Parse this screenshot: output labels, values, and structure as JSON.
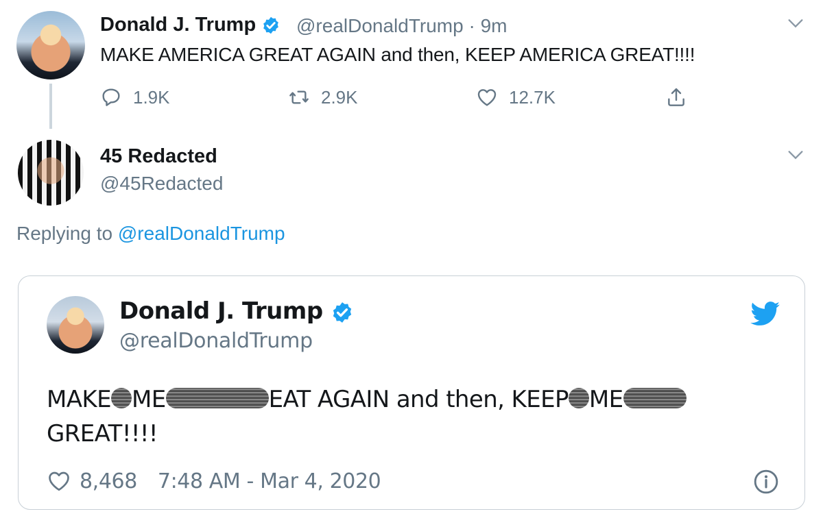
{
  "tweet": {
    "author_name": "Donald J. Trump",
    "handle": "@realDonaldTrump",
    "separator": "·",
    "time": "9m",
    "text": "MAKE AMERICA GREAT AGAIN and then, KEEP AMERICA GREAT!!!!",
    "replies": "1.9K",
    "retweets": "2.9K",
    "likes": "12.7K"
  },
  "reply": {
    "author_name": "45 Redacted",
    "handle": "@45Redacted",
    "replying_prefix": "Replying to",
    "replying_to": "@realDonaldTrump"
  },
  "embed": {
    "author_name": "Donald J. Trump",
    "handle": "@realDonaldTrump",
    "text_parts": [
      "MAKE",
      "ME",
      "EAT AGAIN and then, KEEP",
      "ME",
      "GREAT!!!!"
    ],
    "likes": "8,468",
    "timestamp": "7:48 AM - Mar 4, 2020"
  },
  "colors": {
    "accent": "#1b95e0",
    "verified": "#1da1f2",
    "muted": "#657786"
  },
  "icons": [
    "verified-badge-icon",
    "chevron-down-icon",
    "reply-icon",
    "retweet-icon",
    "like-icon",
    "share-icon",
    "twitter-bird-icon",
    "info-icon"
  ]
}
